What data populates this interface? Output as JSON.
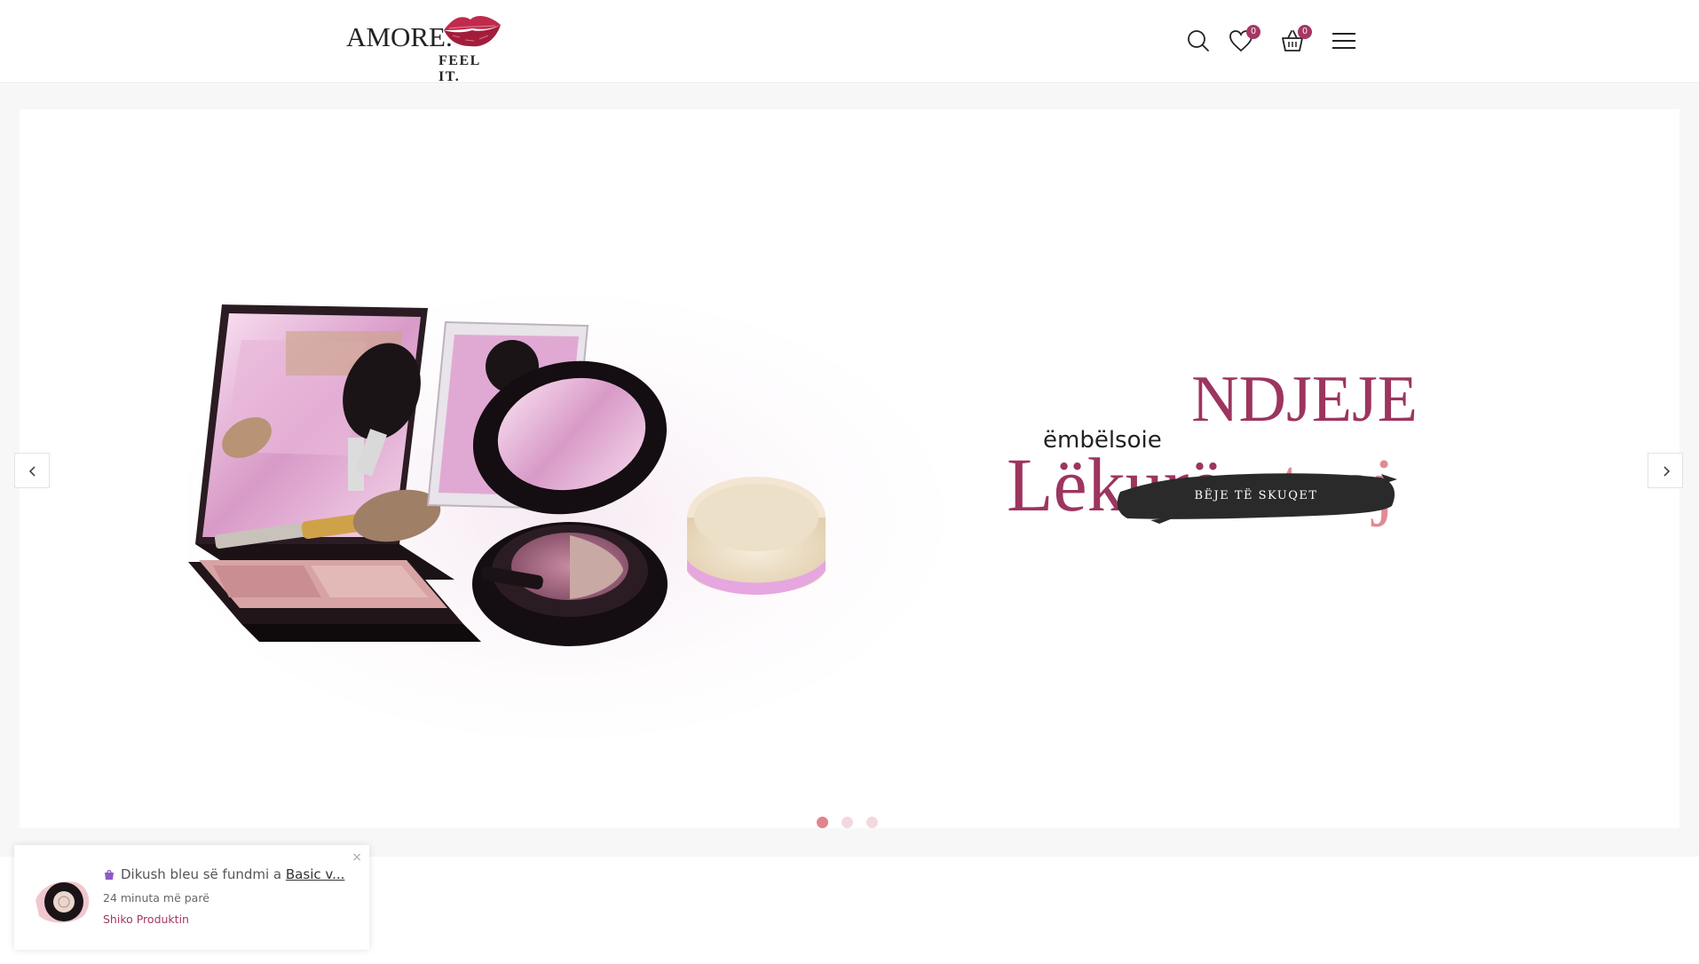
{
  "header": {
    "logo_word": "AMORE.",
    "logo_tagline": "FEEL IT.",
    "wishlist_count": "0",
    "cart_count": "0",
    "icons": [
      "search-icon",
      "heart-icon",
      "basket-icon",
      "menu-icon"
    ]
  },
  "hero": {
    "title_top": "NDJEJE",
    "title_small": "ëmbëlsoie",
    "title_main_1": "Lëkurën",
    "title_main_2": "tuaj",
    "cta_label": "BËJE TË SKUQET",
    "slides_count": 3,
    "active_slide": 1
  },
  "toast": {
    "message_prefix": "Dikush bleu së fundmi a",
    "product_link": "Basic v...",
    "time_ago": "24 minuta më parë",
    "view_label": "Shiko Produktin",
    "close_label": "×"
  },
  "colors": {
    "accent_plum": "#9c355f",
    "accent_pink": "#e08b95",
    "badge": "#a43766",
    "cta_bg": "#2a2a2a"
  }
}
